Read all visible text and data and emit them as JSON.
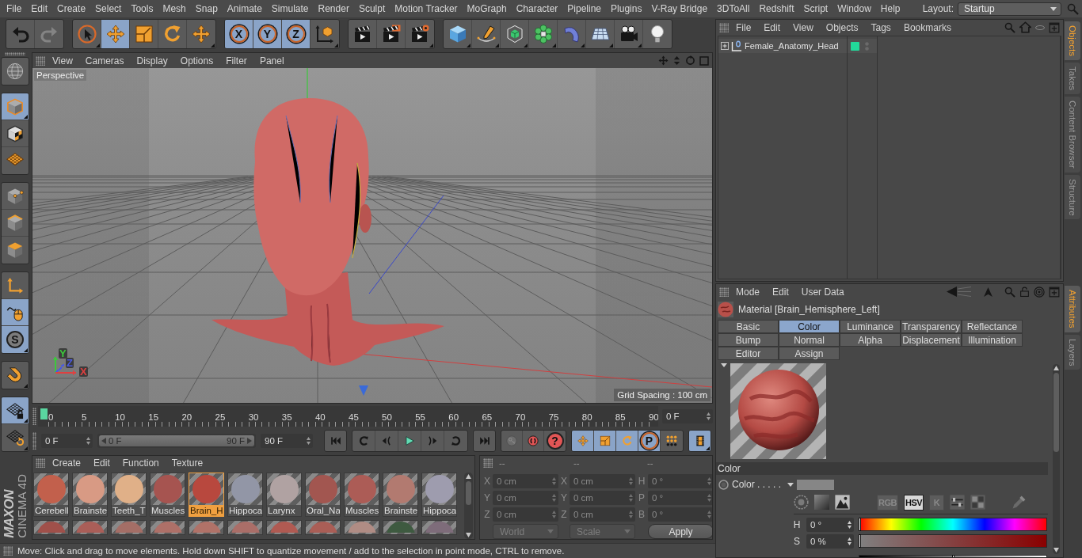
{
  "menu_bar": {
    "items": [
      "File",
      "Edit",
      "Create",
      "Select",
      "Tools",
      "Mesh",
      "Snap",
      "Animate",
      "Simulate",
      "Render",
      "Sculpt",
      "Motion Tracker",
      "MoGraph",
      "Character",
      "Pipeline",
      "Plugins",
      "V-Ray Bridge",
      "3DToAll",
      "Redshift",
      "Script",
      "Window",
      "Help"
    ],
    "layout_label": "Layout:",
    "layout_value": "Startup"
  },
  "toolbar": {
    "groups": [
      [
        {
          "kind": "undo",
          "active": false,
          "disabled": false,
          "menu": false
        },
        {
          "kind": "redo",
          "active": false,
          "disabled": true,
          "menu": false
        }
      ],
      [
        {
          "kind": "select",
          "active": false,
          "menu": true
        },
        {
          "kind": "move",
          "active": true,
          "menu": false
        },
        {
          "kind": "scale",
          "active": false,
          "menu": false
        },
        {
          "kind": "rotate",
          "active": false,
          "menu": false
        },
        {
          "kind": "transform",
          "active": false,
          "menu": true
        }
      ],
      [
        {
          "kind": "axis",
          "label": "X",
          "active": true,
          "menu": false
        },
        {
          "kind": "axis",
          "label": "Y",
          "active": true,
          "menu": false
        },
        {
          "kind": "axis",
          "label": "Z",
          "active": true,
          "menu": false
        },
        {
          "kind": "coordinates",
          "active": false,
          "menu": true
        }
      ],
      [
        {
          "kind": "render",
          "active": false,
          "menu": false
        },
        {
          "kind": "picture",
          "active": false,
          "menu": false
        },
        {
          "kind": "settings",
          "active": false,
          "menu": true
        }
      ],
      [
        {
          "kind": "cube",
          "active": false,
          "menu": true
        },
        {
          "kind": "pen",
          "active": false,
          "menu": true
        },
        {
          "kind": "subdivision",
          "active": false,
          "menu": true
        },
        {
          "kind": "cloner",
          "active": false,
          "menu": true
        },
        {
          "kind": "deformer",
          "active": false,
          "menu": true
        },
        {
          "kind": "floor",
          "active": false,
          "menu": true
        },
        {
          "kind": "camera",
          "active": false,
          "menu": true
        },
        {
          "kind": "light",
          "active": false,
          "menu": false
        }
      ]
    ]
  },
  "left_toolbar": {
    "groups": [
      [
        {
          "kind": "editable",
          "active": false,
          "menu": false
        }
      ],
      [
        {
          "kind": "model",
          "active": true,
          "menu": true
        },
        {
          "kind": "texture",
          "active": false,
          "menu": false
        },
        {
          "kind": "workplane",
          "active": false,
          "menu": false
        }
      ],
      [
        {
          "kind": "points",
          "active": false,
          "menu": false
        },
        {
          "kind": "edges",
          "active": false,
          "menu": false
        },
        {
          "kind": "polygons",
          "active": false,
          "menu": false
        }
      ],
      [
        {
          "kind": "axes",
          "active": false,
          "menu": false
        },
        {
          "kind": "tweak",
          "active": true,
          "menu": false
        },
        {
          "kind": "solo",
          "label": "S",
          "active": true,
          "menu": true
        }
      ],
      [
        {
          "kind": "magnet",
          "active": false,
          "menu": true
        }
      ],
      [
        {
          "kind": "gridlock",
          "active": true,
          "menu": true
        },
        {
          "kind": "gridrotate",
          "active": false,
          "menu": true
        }
      ]
    ]
  },
  "logo": {
    "brand": "MAXON",
    "product": "CINEMA 4D"
  },
  "viewport": {
    "menu": [
      "View",
      "Cameras",
      "Display",
      "Options",
      "Filter",
      "Panel"
    ],
    "camera": "Perspective",
    "grid_info": "Grid Spacing : 100 cm",
    "axes": [
      {
        "label": "Y",
        "color": "#3cc83c"
      },
      {
        "label": "Z",
        "color": "#4a5ae0"
      },
      {
        "label": "X",
        "color": "#e04040"
      }
    ]
  },
  "timeline": {
    "ticks": [
      "0",
      "5",
      "10",
      "15",
      "20",
      "25",
      "30",
      "35",
      "40",
      "45",
      "50",
      "55",
      "60",
      "65",
      "70",
      "75",
      "80",
      "85",
      "90"
    ],
    "level": 0,
    "current_frame": "0 F"
  },
  "transport": {
    "start_field": "0 F",
    "range": {
      "start": "0 F",
      "end": "90 F",
      "level": 1
    },
    "end_field": "90 F",
    "groups": [
      [
        {
          "kind": "start",
          "active": false,
          "menu": false
        }
      ],
      [
        {
          "kind": "prevkey",
          "active": false,
          "menu": false
        },
        {
          "kind": "prevframe",
          "active": false,
          "menu": false
        },
        {
          "kind": "play",
          "active": false,
          "menu": false
        },
        {
          "kind": "nextframe",
          "active": false,
          "menu": false
        },
        {
          "kind": "nextkey",
          "active": false,
          "menu": false
        }
      ],
      [
        {
          "kind": "end",
          "active": false,
          "menu": false
        }
      ],
      [
        {
          "kind": "key",
          "active": false,
          "disabled": true,
          "menu": false
        },
        {
          "kind": "record",
          "active": false,
          "disabled": false,
          "menu": false
        },
        {
          "kind": "autokey",
          "label": "?",
          "active": false,
          "disabled": false,
          "menu": false
        }
      ],
      [
        {
          "kind": "move",
          "active": true,
          "menu": false
        },
        {
          "kind": "scale",
          "active": true,
          "menu": false
        },
        {
          "kind": "rotate",
          "active": true,
          "menu": false
        },
        {
          "kind": "param",
          "label": "P",
          "active": true,
          "menu": false
        },
        {
          "kind": "dots",
          "active": false,
          "menu": false
        }
      ],
      [
        {
          "kind": "film",
          "active": true,
          "menu": true
        }
      ]
    ]
  },
  "materials": {
    "menu": [
      "Create",
      "Edit",
      "Function",
      "Texture"
    ],
    "items": [
      {
        "name": "Cerebell",
        "color": "#c2604c",
        "selected": false
      },
      {
        "name": "Brainste",
        "color": "#d89a84",
        "selected": false
      },
      {
        "name": "Teeth_T",
        "color": "#e0b088",
        "selected": false
      },
      {
        "name": "Muscles",
        "color": "#a65450",
        "selected": false
      },
      {
        "name": "Brain_H",
        "color": "#b8483e",
        "selected": true
      },
      {
        "name": "Hippoca",
        "color": "#9296a6",
        "selected": false
      },
      {
        "name": "Larynx",
        "color": "#b0a2a2",
        "selected": false
      },
      {
        "name": "Oral_Na",
        "color": "#a25650",
        "selected": false
      },
      {
        "name": "Muscles",
        "color": "#ac5c56",
        "selected": false
      },
      {
        "name": "Brainste",
        "color": "#b27a70",
        "selected": false
      },
      {
        "name": "Hippoca",
        "color": "#9e9cae",
        "selected": false
      }
    ],
    "row_2": [
      {
        "color": "#a0504a",
        "selected": false
      },
      {
        "color": "#aa5e58",
        "selected": false
      },
      {
        "color": "#a46e66",
        "selected": false
      },
      {
        "color": "#ae7068",
        "selected": false
      },
      {
        "color": "#b07268",
        "selected": false
      },
      {
        "color": "#aa6e68",
        "selected": false
      },
      {
        "color": "#b05a52",
        "selected": false
      },
      {
        "color": "#aa5e56",
        "selected": false
      },
      {
        "color": "#b08c84",
        "selected": false
      },
      {
        "color": "#3e5a40",
        "selected": false
      },
      {
        "color": "#7e6c7a",
        "selected": false
      }
    ]
  },
  "coordinates": {
    "disabled": true,
    "headers": [
      "--",
      "--",
      "--"
    ],
    "rows": [
      [
        {
          "axis": "X",
          "value": "0 cm"
        },
        {
          "axis": "X",
          "value": "0 cm"
        },
        {
          "axis": "H",
          "value": "0 °"
        }
      ],
      [
        {
          "axis": "Y",
          "value": "0 cm"
        },
        {
          "axis": "Y",
          "value": "0 cm"
        },
        {
          "axis": "P",
          "value": "0 °"
        }
      ],
      [
        {
          "axis": "Z",
          "value": "0 cm"
        },
        {
          "axis": "Z",
          "value": "0 cm"
        },
        {
          "axis": "B",
          "value": "0 °"
        }
      ]
    ],
    "mode": "World",
    "transform": "Scale",
    "apply": "Apply"
  },
  "status_bar": {
    "text": "Move: Click and drag to move elements. Hold down SHIFT to quantize movement / add to the selection in point mode, CTRL to remove."
  },
  "object_manager": {
    "menu": [
      "File",
      "Edit",
      "View",
      "Objects",
      "Tags",
      "Bookmarks"
    ],
    "objects": [
      {
        "name": "Female_Anatomy_Head",
        "expanded": false
      }
    ]
  },
  "side_tabs_top": [
    {
      "label": "Objects",
      "selected": true
    },
    {
      "label": "Takes",
      "selected": false
    },
    {
      "label": "Content Browser",
      "selected": false
    },
    {
      "label": "Structure",
      "selected": false
    }
  ],
  "attributes": {
    "menu": [
      "Mode",
      "Edit",
      "User Data"
    ],
    "title": "Material [Brain_Hemisphere_Left]",
    "tabs": [
      {
        "label": "Basic",
        "selected": false
      },
      {
        "label": "Color",
        "selected": true
      },
      {
        "label": "Luminance",
        "selected": false
      },
      {
        "label": "Transparency",
        "selected": false
      },
      {
        "label": "Reflectance",
        "selected": false
      },
      {
        "label": "Bump",
        "selected": false
      },
      {
        "label": "Normal",
        "selected": false
      },
      {
        "label": "Alpha",
        "selected": false
      },
      {
        "label": "Displacement",
        "selected": false
      },
      {
        "label": "Illumination",
        "selected": false
      },
      {
        "label": "Editor",
        "selected": false
      },
      {
        "label": "Assign",
        "selected": false
      }
    ],
    "section": "Color",
    "color_label": "Color . . . . .",
    "modes": [
      {
        "label": "RGB",
        "selected": false
      },
      {
        "label": "HSV",
        "selected": true
      },
      {
        "label": "K",
        "selected": false
      }
    ],
    "sliders": [
      {
        "kind": "hue",
        "label": "H",
        "value": "0 °",
        "level": 0
      },
      {
        "kind": "saturation",
        "label": "S",
        "value": "0 %",
        "level": 0
      },
      {
        "kind": "value",
        "level": 0.5
      }
    ]
  },
  "side_tabs_bottom": [
    {
      "label": "Attributes",
      "selected": true
    },
    {
      "label": "Layers",
      "selected": false
    }
  ]
}
